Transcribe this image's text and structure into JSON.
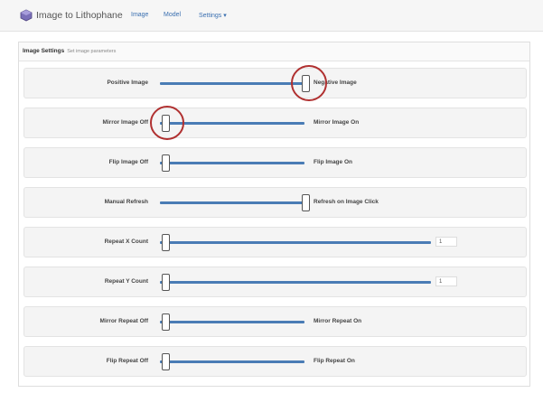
{
  "navbar": {
    "brand": "Image to Lithophane",
    "links": [
      "Image",
      "Model",
      "Settings ▾"
    ],
    "accent_color": "#3a6fb0"
  },
  "panel": {
    "title": "Image Settings",
    "subtitle": "Set image parameters"
  },
  "settings": [
    {
      "left": "Positive Image",
      "right": "Negative Image",
      "value": 1
    },
    {
      "left": "Mirror Image Off",
      "right": "Mirror Image On",
      "value": 0
    },
    {
      "left": "Flip Image Off",
      "right": "Flip Image On",
      "value": 0
    },
    {
      "left": "Manual Refresh",
      "right": "Refresh on Image Click",
      "value": 1
    },
    {
      "left": "Repeat X Count",
      "number": "1",
      "value": 1
    },
    {
      "left": "Repeat Y Count",
      "number": "1",
      "value": 1
    },
    {
      "left": "Mirror Repeat Off",
      "right": "Mirror Repeat On",
      "value": 0
    },
    {
      "left": "Flip Repeat Off",
      "right": "Flip Repeat On",
      "value": 0
    }
  ],
  "colors": {
    "slider_track": "#4a7cb5",
    "highlight_circle": "#b03030"
  }
}
